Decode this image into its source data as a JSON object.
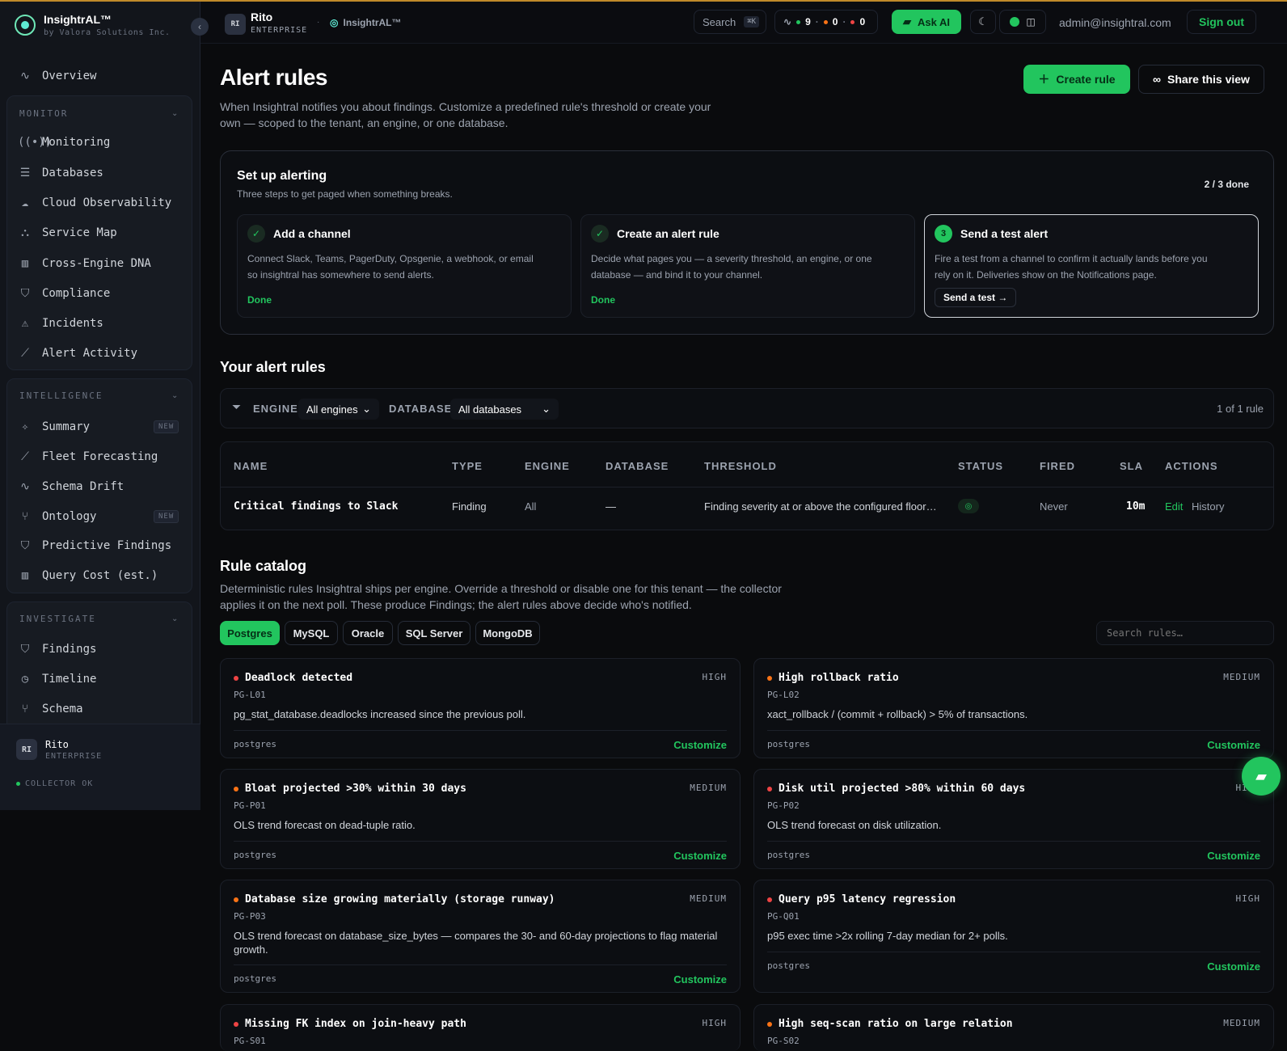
{
  "app": {
    "name": "InsightrAL™",
    "vendor": "by Valora Solutions Inc."
  },
  "topbar": {
    "org_initials": "RI",
    "org_name": "Rito",
    "org_plan": "ENTERPRISE",
    "product": "InsightrAL™",
    "search_label": "Search",
    "search_shortcut": "⌘K",
    "health_counts": [
      "9",
      "0",
      "0"
    ],
    "ask_ai": "Ask AI",
    "user_email": "admin@insightral.com",
    "sign_out": "Sign out"
  },
  "sidebar": {
    "overview": "Overview",
    "monitor": {
      "title": "MONITOR",
      "items": [
        "Monitoring",
        "Databases",
        "Cloud Observability",
        "Service Map",
        "Cross-Engine DNA",
        "Compliance",
        "Incidents",
        "Alert Activity"
      ]
    },
    "intelligence": {
      "title": "INTELLIGENCE",
      "items": [
        "Summary",
        "Fleet Forecasting",
        "Schema Drift",
        "Ontology",
        "Predictive Findings",
        "Query Cost (est.)"
      ],
      "badge": "NEW"
    },
    "investigate": {
      "title": "INVESTIGATE",
      "items": [
        "Findings",
        "Timeline",
        "Schema"
      ]
    },
    "user": {
      "initials": "RI",
      "name": "Rito",
      "plan": "ENTERPRISE",
      "collector": "COLLECTOR OK"
    }
  },
  "page": {
    "title": "Alert rules",
    "subtitle_1": "When Insightral notifies you about findings. Customize a predefined rule's threshold or create your",
    "subtitle_2": "own — scoped to the tenant, an engine, or one database.",
    "create_rule": "Create rule",
    "share_view": "Share this view"
  },
  "setup": {
    "title": "Set up alerting",
    "subtitle": "Three steps to get paged when something breaks.",
    "progress": "2 / 3 done",
    "steps": [
      {
        "title": "Add a channel",
        "desc_1": "Connect Slack, Teams, PagerDuty, Opsgenie, a webhook, or email",
        "desc_2": "so insightral has somewhere to send alerts.",
        "status": "Done"
      },
      {
        "title": "Create an alert rule",
        "desc_1": "Decide what pages you — a severity threshold, an engine, or one",
        "desc_2": "database — and bind it to your channel.",
        "status": "Done"
      },
      {
        "number": "3",
        "title": "Send a test alert",
        "desc_1": "Fire a test from a channel to confirm it actually lands before you",
        "desc_2": "rely on it. Deliveries show on the Notifications page.",
        "action": "Send a test →"
      }
    ]
  },
  "rules": {
    "title": "Your alert rules",
    "filter": {
      "engine_label": "ENGINE",
      "engine_value": "All engines",
      "db_label": "DATABASE",
      "db_value": "All databases",
      "count": "1 of 1 rule"
    },
    "columns": [
      "NAME",
      "TYPE",
      "ENGINE",
      "DATABASE",
      "THRESHOLD",
      "STATUS",
      "FIRED",
      "SLA",
      "ACTIONS"
    ],
    "rows": [
      {
        "name": "Critical findings to Slack",
        "type": "Finding",
        "engine": "All",
        "database": "—",
        "threshold": "Finding severity at or above the configured floor…",
        "fired": "Never",
        "sla": "10m",
        "edit": "Edit",
        "history": "History"
      }
    ]
  },
  "catalog": {
    "title": "Rule catalog",
    "desc_1": "Deterministic rules Insightral ships per engine. Override a threshold or disable one for this tenant — the collector",
    "desc_2": "applies it on the next poll. These produce Findings; the alert rules above decide who's notified.",
    "tabs": [
      "Postgres",
      "MySQL",
      "Oracle",
      "SQL Server",
      "MongoDB"
    ],
    "search_placeholder": "Search rules…",
    "customize": "Customize",
    "colors": {
      "high": "#ef4444",
      "medium": "#f97316"
    },
    "rules": [
      {
        "name": "Deadlock detected",
        "id": "PG-L01",
        "severity": "HIGH",
        "desc": "pg_stat_database.deadlocks increased since the previous poll.",
        "engine": "postgres"
      },
      {
        "name": "High rollback ratio",
        "id": "PG-L02",
        "severity": "MEDIUM",
        "desc": "xact_rollback / (commit + rollback) > 5% of transactions.",
        "engine": "postgres"
      },
      {
        "name": "Bloat projected >30% within 30 days",
        "id": "PG-P01",
        "severity": "MEDIUM",
        "desc": "OLS trend forecast on dead-tuple ratio.",
        "engine": "postgres"
      },
      {
        "name": "Disk util projected >80% within 60 days",
        "id": "PG-P02",
        "severity": "HIGH",
        "desc": "OLS trend forecast on disk utilization.",
        "engine": "postgres"
      },
      {
        "name": "Database size growing materially (storage runway)",
        "id": "PG-P03",
        "severity": "MEDIUM",
        "desc": "OLS trend forecast on database_size_bytes — compares the 30- and 60-day projections to flag material growth.",
        "engine": "postgres"
      },
      {
        "name": "Query p95 latency regression",
        "id": "PG-Q01",
        "severity": "HIGH",
        "desc": "p95 exec time >2x rolling 7-day median for 2+ polls.",
        "engine": "postgres"
      },
      {
        "name": "Missing FK index on join-heavy path",
        "id": "PG-S01",
        "severity": "HIGH"
      },
      {
        "name": "High seq-scan ratio on large relation",
        "id": "PG-S02",
        "severity": "MEDIUM"
      }
    ]
  }
}
